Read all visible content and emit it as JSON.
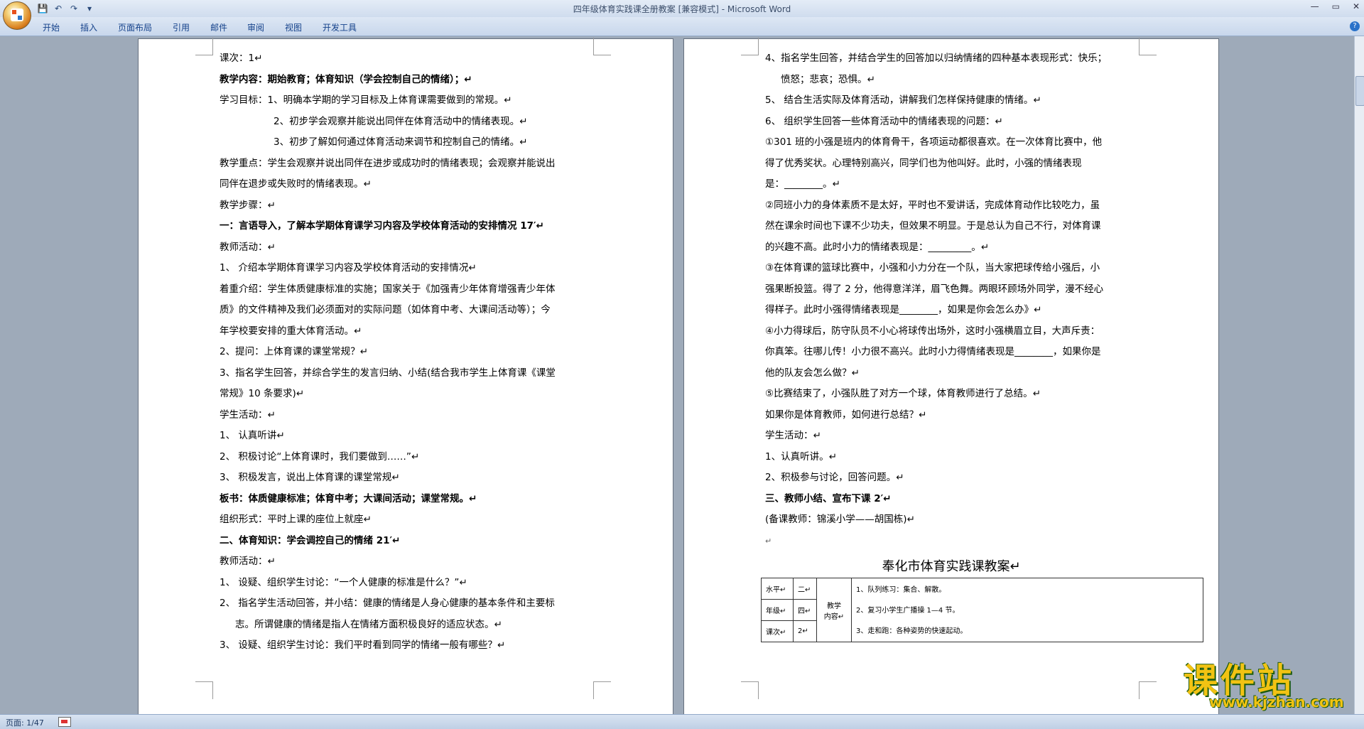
{
  "window": {
    "title": "四年级体育实践课全册教案 [兼容模式] - Microsoft Word",
    "controls": [
      "—",
      "▭",
      "✕"
    ]
  },
  "quick_access": {
    "save": "💾",
    "undo": "↶",
    "redo": "↷",
    "customize": "▾"
  },
  "ribbon": {
    "tabs": [
      "开始",
      "插入",
      "页面布局",
      "引用",
      "邮件",
      "审阅",
      "视图",
      "开发工具"
    ],
    "help": "?"
  },
  "page1": {
    "lines": [
      {
        "t": "课次：1↵",
        "s": ""
      },
      {
        "t": "教学内容：期始教育；体育知识（学会控制自己的情绪）；↵",
        "s": "b"
      },
      {
        "t": "学习目标：1、明确本学期的学习目标及上体育课需要做到的常规。↵",
        "s": ""
      },
      {
        "t": "2、初步学会观察并能说出同伴在体育活动中的情绪表现。↵",
        "s": "ind"
      },
      {
        "t": "3、初步了解如何通过体育活动来调节和控制自己的情绪。↵",
        "s": "ind"
      },
      {
        "t": "教学重点：学生会观察并说出同伴在进步或成功时的情绪表现；会观察并能说出",
        "s": ""
      },
      {
        "t": "同伴在退步或失败时的情绪表现。↵",
        "s": ""
      },
      {
        "t": "教学步骤：↵",
        "s": ""
      },
      {
        "t": "一：言语导入，了解本学期体育课学习内容及学校体育活动的安排情况 17′↵",
        "s": "b"
      },
      {
        "t": "教师活动：↵",
        "s": ""
      },
      {
        "t": "1、 介绍本学期体育课学习内容及学校体育活动的安排情况↵",
        "s": ""
      },
      {
        "t": "着重介绍：学生体质健康标准的实施；国家关于《加强青少年体育增强青少年体",
        "s": ""
      },
      {
        "t": "质》的文件精神及我们必须面对的实际问题（如体育中考、大课间活动等）；今",
        "s": ""
      },
      {
        "t": "年学校要安排的重大体育活动。↵",
        "s": ""
      },
      {
        "t": "2、提问：上体育课的课堂常规？↵",
        "s": ""
      },
      {
        "t": "3、指名学生回答，并综合学生的发言归纳、小结(结合我市学生上体育课《课堂",
        "s": ""
      },
      {
        "t": "常规》10 条要求)↵",
        "s": ""
      },
      {
        "t": "学生活动：↵",
        "s": ""
      },
      {
        "t": "1、 认真听讲↵",
        "s": ""
      },
      {
        "t": "2、 积极讨论“上体育课时，我们要做到……”↵",
        "s": ""
      },
      {
        "t": "3、 积极发言，说出上体育课的课堂常规↵",
        "s": ""
      },
      {
        "t": "板书：体质健康标准；体育中考；大课间活动；课堂常规。↵",
        "s": "b"
      },
      {
        "t": "组织形式：平时上课的座位上就座↵",
        "s": ""
      },
      {
        "t": "二、体育知识：学会调控自己的情绪 21′↵",
        "s": "b"
      },
      {
        "t": "教师活动：↵",
        "s": ""
      },
      {
        "t": "1、 设疑、组织学生讨论：“一个人健康的标准是什么？”↵",
        "s": ""
      },
      {
        "t": "2、 指名学生活动回答，并小结：健康的情绪是人身心健康的基本条件和主要标",
        "s": ""
      },
      {
        "t": "志。所谓健康的情绪是指人在情绪方面积极良好的适应状态。↵",
        "s": "ind2"
      },
      {
        "t": "3、 设疑、组织学生讨论：我们平时看到同学的情绪一般有哪些？↵",
        "s": ""
      }
    ]
  },
  "page2": {
    "lines": [
      {
        "t": "4、指名学生回答，并结合学生的回答加以归纳情绪的四种基本表现形式：快乐；",
        "s": ""
      },
      {
        "t": "愤怒；悲哀；恐惧。↵",
        "s": "ind2"
      },
      {
        "t": "5、 结合生活实际及体育活动，讲解我们怎样保持健康的情绪。↵",
        "s": ""
      },
      {
        "t": "6、 组织学生回答一些体育活动中的情绪表现的问题：↵",
        "s": ""
      },
      {
        "t": "①301 班的小强是班内的体育骨干，各项运动都很喜欢。在一次体育比赛中，他",
        "s": ""
      },
      {
        "t": "得了优秀奖状。心理特别高兴，同学们也为他叫好。此时，小强的情绪表现",
        "s": ""
      },
      {
        "t": "是：________。↵",
        "s": ""
      },
      {
        "t": "②同班小力的身体素质不是太好，平时也不爱讲话，完成体育动作比较吃力，虽",
        "s": ""
      },
      {
        "t": "然在课余时间也下课不少功夫，但效果不明显。于是总认为自己不行，对体育课",
        "s": ""
      },
      {
        "t": "的兴趣不高。此时小力的情绪表现是：_________。↵",
        "s": ""
      },
      {
        "t": "③在体育课的篮球比赛中，小强和小力分在一个队，当大家把球传给小强后，小",
        "s": ""
      },
      {
        "t": "强果断投篮。得了 2 分，他得意洋洋，眉飞色舞。两眼环顾场外同学，漫不经心",
        "s": ""
      },
      {
        "t": "得样子。此时小强得情绪表现是________，如果是你会怎么办》↵",
        "s": ""
      },
      {
        "t": "④小力得球后，防守队员不小心将球传出场外，这时小强横眉立目，大声斥责：",
        "s": ""
      },
      {
        "t": "你真笨。往哪儿传！小力很不高兴。此时小力得情绪表现是________，如果你是",
        "s": ""
      },
      {
        "t": "他的队友会怎么做？↵",
        "s": ""
      },
      {
        "t": "⑤比赛结束了，小强队胜了对方一个球，体育教师进行了总结。↵",
        "s": ""
      },
      {
        "t": "如果你是体育教师，如何进行总结？↵",
        "s": ""
      },
      {
        "t": "学生活动：↵",
        "s": ""
      },
      {
        "t": "1、认真听讲。↵",
        "s": ""
      },
      {
        "t": "2、积极参与讨论，回答问题。↵",
        "s": ""
      },
      {
        "t": "三、教师小结、宣布下课 2′↵",
        "s": "b"
      },
      {
        "t": "(备课教师：锦溪小学——胡国栋)↵",
        "s": ""
      },
      {
        "t": "↵",
        "s": "pm"
      }
    ],
    "title2": "奉化市体育实践课教案↵",
    "table": {
      "r1": [
        "水平↵",
        "二↵"
      ],
      "r2": [
        "年级↵",
        "四↵"
      ],
      "r3": [
        "课次↵",
        "2↵"
      ],
      "section": "教学\n内容↵",
      "items": [
        "1、队列练习：集合、解散。",
        "2、复习小学生广播操 1—4 节。",
        "3、走和跑：各种姿势的快速起动。"
      ]
    }
  },
  "statusbar": {
    "page": "页面: 1/47"
  },
  "watermark": {
    "brand": "课件站",
    "url": "www.kjzhan.com"
  }
}
